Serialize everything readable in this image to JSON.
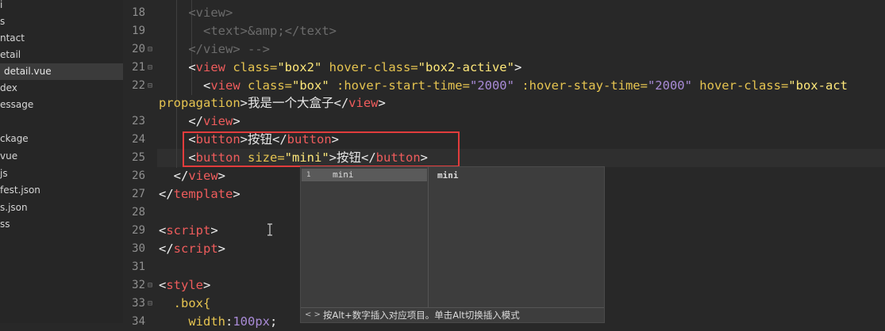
{
  "sidebar": {
    "items": [
      {
        "label": "i"
      },
      {
        "label": "s"
      },
      {
        "label": "ntact"
      },
      {
        "label": "etail"
      },
      {
        "label": "detail.vue"
      },
      {
        "label": "dex"
      },
      {
        "label": "essage"
      },
      {
        "label": ""
      },
      {
        "label": "ckage"
      },
      {
        "label": "vue"
      },
      {
        "label": "js"
      },
      {
        "label": "fest.json"
      },
      {
        "label": "s.json"
      },
      {
        "label": "ss"
      }
    ]
  },
  "editor": {
    "line_numbers": [
      "18",
      "19",
      "20",
      "21",
      "22",
      "23",
      "24",
      "25",
      "26",
      "27",
      "28",
      "29",
      "30",
      "31",
      "32",
      "33",
      "34"
    ],
    "lines": {
      "l18": {
        "open": "<",
        "name": "view",
        "close": ">"
      },
      "l19": {
        "open": "<",
        "name": "text",
        "mid": ">&amp;</",
        "name2": "text",
        "close": ">"
      },
      "l20": {
        "open": "</",
        "name": "view",
        "close": "> -->"
      },
      "l21": {
        "open": "<",
        "name": "view",
        "a1": " class=",
        "v1": "\"box2\"",
        "a2": " hover-class=",
        "v2": "\"box2-active\"",
        "close": ">"
      },
      "l22": {
        "open": "<",
        "name": "view",
        "a1": " class=",
        "v1": "\"box\"",
        "a2": " :hover-start-time=",
        "v2": "\"2000\"",
        "a3": " :hover-stay-time=",
        "v3": "\"2000\"",
        "a4": " hover-class=",
        "v4": "\"box-act"
      },
      "l22b": {
        "attr": "propagation",
        "text": ">我是一个大盒子</",
        "name": "view",
        "close": ">"
      },
      "l23": {
        "open": "</",
        "name": "view",
        "close": ">"
      },
      "l24": {
        "open": "<",
        "name": "button",
        "text": ">按钮</",
        "name2": "button",
        "close": ">"
      },
      "l25": {
        "open": "<",
        "name": "button",
        "a1": " size=",
        "v1": "\"mini\"",
        "text": ">按钮</",
        "name2": "button",
        "close": ">"
      },
      "l26": {
        "open": "</",
        "name": "view",
        "close": ">"
      },
      "l27": {
        "open": "</",
        "name": "template",
        "close": ">"
      },
      "l29": {
        "open": "<",
        "name": "script",
        "close": ">"
      },
      "l30": {
        "open": "</",
        "name": "script",
        "close": ">"
      },
      "l32": {
        "open": "<",
        "name": "style",
        "close": ">"
      },
      "l33": {
        "sel": ".box{"
      },
      "l34": {
        "prop": "width",
        "punct": ":",
        "num": "100px",
        "end": ";"
      }
    }
  },
  "autocomplete": {
    "item_index": "1",
    "item_label": "mini",
    "detail": "mini",
    "hint_icon": "< >",
    "hint": "按Alt+数字插入对应项目。单击Alt切换插入模式"
  }
}
